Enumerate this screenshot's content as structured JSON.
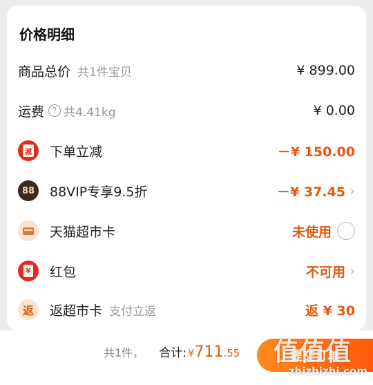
{
  "section_title": "价格明细",
  "rows": {
    "goods_total": {
      "label": "商品总价",
      "sub": "共1件宝贝",
      "value": "¥ 899.00"
    },
    "shipping": {
      "label": "运费",
      "help_glyph": "?",
      "sub": "共4.41kg",
      "value": "¥ 0.00"
    },
    "order_discount": {
      "label": "下单立减",
      "icon_text": "減",
      "value": "－¥ 150.00"
    },
    "vip": {
      "label": "88VIP专享9.5折",
      "icon_text": "88",
      "value": "－¥ 37.45"
    },
    "supermarket_card": {
      "label": "天猫超市卡",
      "value": "未使用"
    },
    "red_packet": {
      "label": "红包",
      "icon_text": "¥",
      "value": "不可用"
    },
    "return_card": {
      "label": "返超市卡",
      "icon_text": "返",
      "sub": "支付立返",
      "value": "返 ¥ 30"
    }
  },
  "bottom": {
    "count": "共1件，",
    "total_label": "合计:",
    "currency": "¥",
    "total_int": "711",
    "total_dec": ".55",
    "submit_label": "提交订单"
  },
  "watermark": {
    "title": "值值值",
    "url": "zhizhizhi.com"
  },
  "colors": {
    "accent": "#e05a10",
    "red": "#e02b1f",
    "button_start": "#ff8a1e",
    "button_end": "#ff5a0a"
  }
}
